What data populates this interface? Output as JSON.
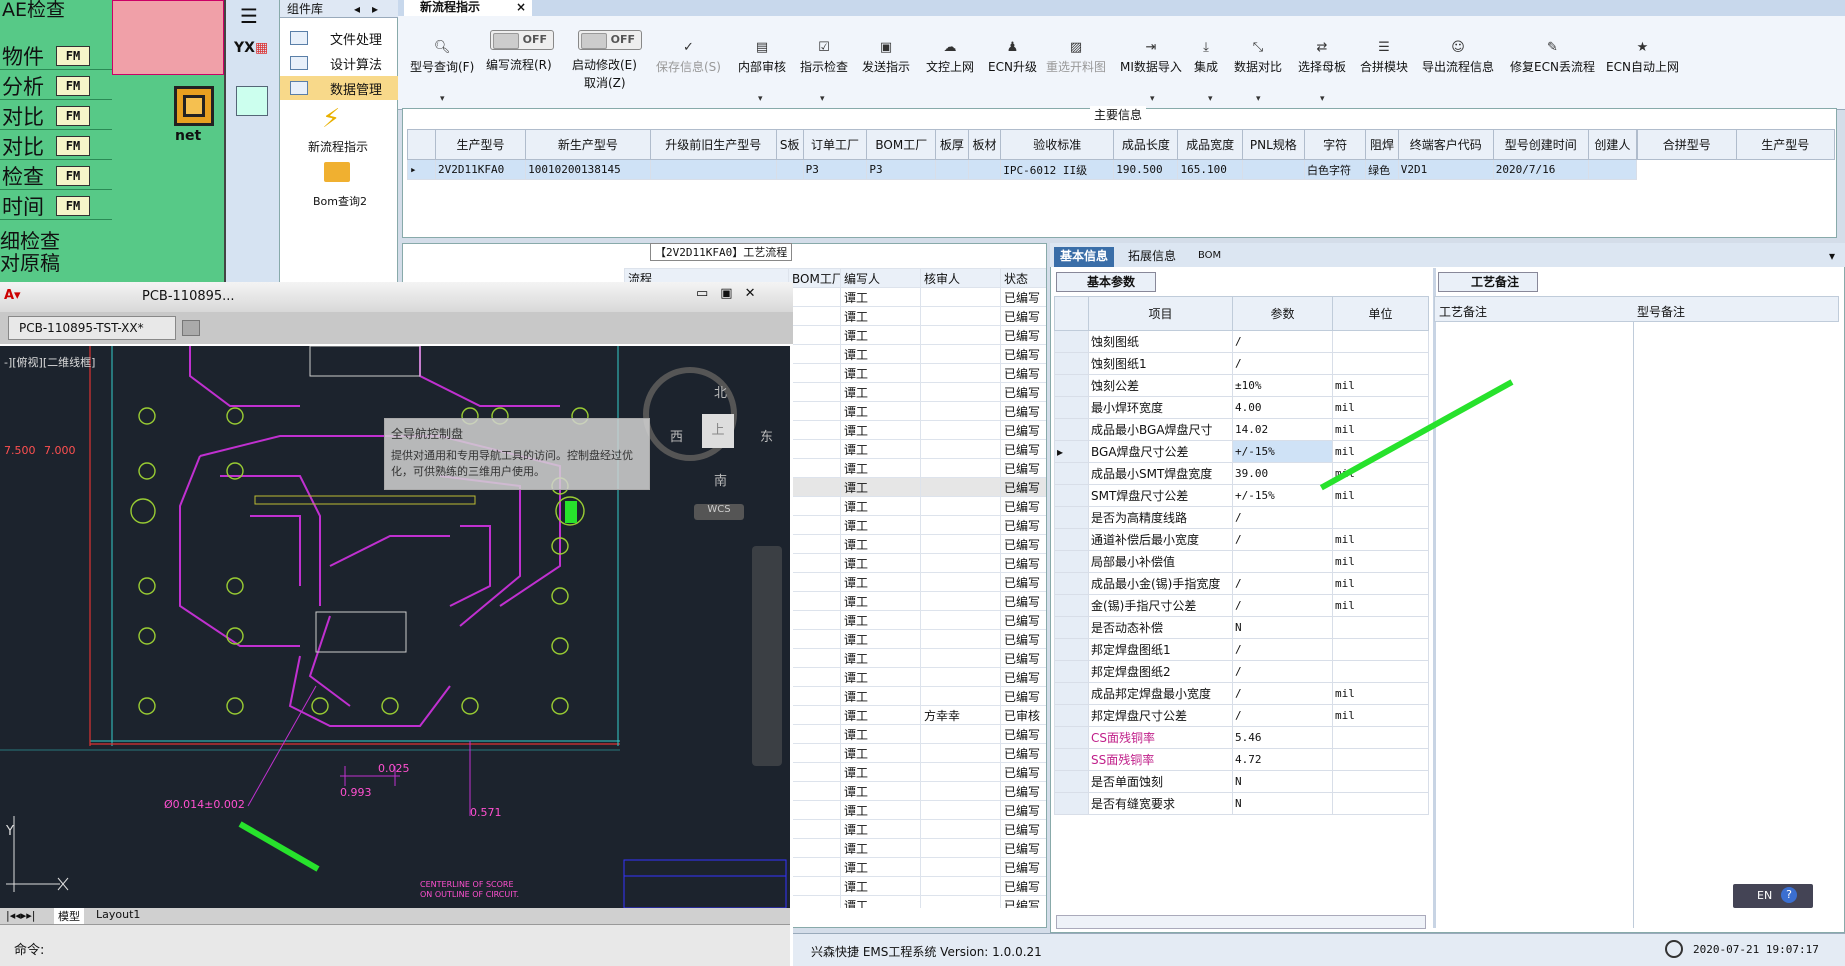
{
  "left_panel": {
    "items": [
      {
        "text": "物件",
        "badge": "FM"
      },
      {
        "text": "分析",
        "badge": "FM"
      },
      {
        "text": "对比",
        "badge": "FM"
      },
      {
        "text": "对比",
        "badge": "FM"
      },
      {
        "text": "检查",
        "badge": "FM"
      },
      {
        "text": "时间",
        "badge": "FM"
      }
    ],
    "top_text1": "AE检查",
    "bottom_text1": "细检查",
    "bottom_text2": "对原稿",
    "net_label": "net"
  },
  "component_library": {
    "title": "组件库",
    "items": [
      "文件处理",
      "设计算法",
      "数据管理"
    ],
    "new_process": "新流程指示",
    "bom_query": "Bom查询2"
  },
  "tab": {
    "title": "新流程指示"
  },
  "toolbar": {
    "model_query": "型号查询(F)",
    "write_toggle": "OFF",
    "write_process": "编写流程(R)",
    "start_toggle": "OFF",
    "start_modify": "启动修改(E)",
    "cancel": "取消(Z)",
    "save_info": "保存信息(S)",
    "internal_review": "内部审核",
    "instruction_check": "指示检查",
    "send_instruction": "发送指示",
    "doc_online": "文控上网",
    "ecn_upgrade": "ECN升级",
    "reselect_drawing": "重选开料图",
    "mi_import": "MI数据导入",
    "integrate": "集成",
    "data_compare": "数据对比",
    "select_mother": "选择母板",
    "merge_module": "合拼模块",
    "export_process": "导出流程信息",
    "fix_ecn_lost": "修复ECN丢流程",
    "ecn_auto_online": "ECN自动上网"
  },
  "main_info": {
    "legend": "主要信息",
    "columns": [
      "生产型号",
      "新生产型号",
      "升级前旧生产型号",
      "S板",
      "订单工厂",
      "BOM工厂",
      "板厚",
      "板材",
      "验收标准",
      "成品长度",
      "成品宽度",
      "PNL规格",
      "字符",
      "阻焊",
      "终端客户代码",
      "型号创建时间",
      "创建人"
    ],
    "row": [
      "2V2D11KFA0",
      "10010200138145",
      "",
      "",
      "P3",
      "P3",
      "",
      "",
      "IPC-6012 II级",
      "190.500",
      "165.100",
      "",
      "白色字符",
      "绿色",
      "V2D1",
      "2020/7/16",
      ""
    ],
    "side_columns": [
      "合拼型号",
      "生产型号"
    ]
  },
  "process": {
    "legend": "【2V2D11KFA0】工艺流程",
    "columns": [
      "流程",
      "BOM工厂",
      "编写人",
      "核审人",
      "状态"
    ],
    "writer": "谭工",
    "reviewer": "方幸幸",
    "status_normal": "已编写",
    "status_review": "已审核"
  },
  "right_panel": {
    "tabs": [
      "基本信息",
      "拓展信息",
      "BOM"
    ],
    "basic_params_tab": "基本参数",
    "process_remark_tab": "工艺备注",
    "columns": [
      "项目",
      "参数",
      "单位"
    ],
    "remark_columns": [
      "工艺备注",
      "型号备注"
    ],
    "rows": [
      {
        "item": "蚀刻图纸",
        "value": "/",
        "unit": ""
      },
      {
        "item": "蚀刻图纸1",
        "value": "/",
        "unit": ""
      },
      {
        "item": "蚀刻公差",
        "value": "±10%",
        "unit": "mil"
      },
      {
        "item": "最小焊环宽度",
        "value": "4.00",
        "unit": "mil"
      },
      {
        "item": "成品最小BGA焊盘尺寸",
        "value": "14.02",
        "unit": "mil"
      },
      {
        "item": "BGA焊盘尺寸公差",
        "value": "+/-15%",
        "unit": "mil"
      },
      {
        "item": "成品最小SMT焊盘宽度",
        "value": "39.00",
        "unit": "mil"
      },
      {
        "item": "SMT焊盘尺寸公差",
        "value": "+/-15%",
        "unit": "mil"
      },
      {
        "item": "是否为高精度线路",
        "value": "/",
        "unit": ""
      },
      {
        "item": "通道补偿后最小宽度",
        "value": "/",
        "unit": "mil"
      },
      {
        "item": "局部最小补偿值",
        "value": "",
        "unit": "mil"
      },
      {
        "item": "成品最小金(锡)手指宽度",
        "value": "/",
        "unit": "mil"
      },
      {
        "item": "金(锡)手指尺寸公差",
        "value": "/",
        "unit": "mil"
      },
      {
        "item": "是否动态补偿",
        "value": "N",
        "unit": ""
      },
      {
        "item": "邦定焊盘图纸1",
        "value": "/",
        "unit": ""
      },
      {
        "item": "邦定焊盘图纸2",
        "value": "/",
        "unit": ""
      },
      {
        "item": "成品邦定焊盘最小宽度",
        "value": "/",
        "unit": "mil"
      },
      {
        "item": "邦定焊盘尺寸公差",
        "value": "/",
        "unit": "mil"
      },
      {
        "item": "CS面残铜率",
        "value": "5.46",
        "unit": ""
      },
      {
        "item": "SS面残铜率",
        "value": "4.72",
        "unit": ""
      },
      {
        "item": "是否单面蚀刻",
        "value": "N",
        "unit": ""
      },
      {
        "item": "是否有缝宽要求",
        "value": "N",
        "unit": ""
      }
    ]
  },
  "cad": {
    "window_title": "PCB-110895...",
    "tab": "PCB-110895-TST-XX*",
    "view_label": "-][俯视][二维线框]",
    "dim1": "7.500",
    "dim2": "7.000",
    "dim3": "0.025",
    "dim4": "0.993",
    "dim5": "0.571",
    "dim6": "Ø0.014±0.002",
    "compass_n": "北",
    "compass_s": "南",
    "compass_e": "东",
    "compass_w": "西",
    "compass_c": "上",
    "wcs": "WCS",
    "note1": "CENTERLINE OF SCORE",
    "note2": "ON OUTLINE OF CIRCUIT.",
    "tooltip_title": "全导航控制盘",
    "tooltip_body": "提供对通用和专用导航工具的访问。控制盘经过优化，可供熟练的三维用户使用。",
    "model_tab": "模型",
    "layout_tab": "Layout1",
    "command_label": "命令:",
    "axis_y": "Y"
  },
  "status": {
    "app": "兴森快捷 EMS工程系统 Version: 1.0.0.21",
    "time": "2020-07-21 19:07:17",
    "lang": "EN"
  }
}
